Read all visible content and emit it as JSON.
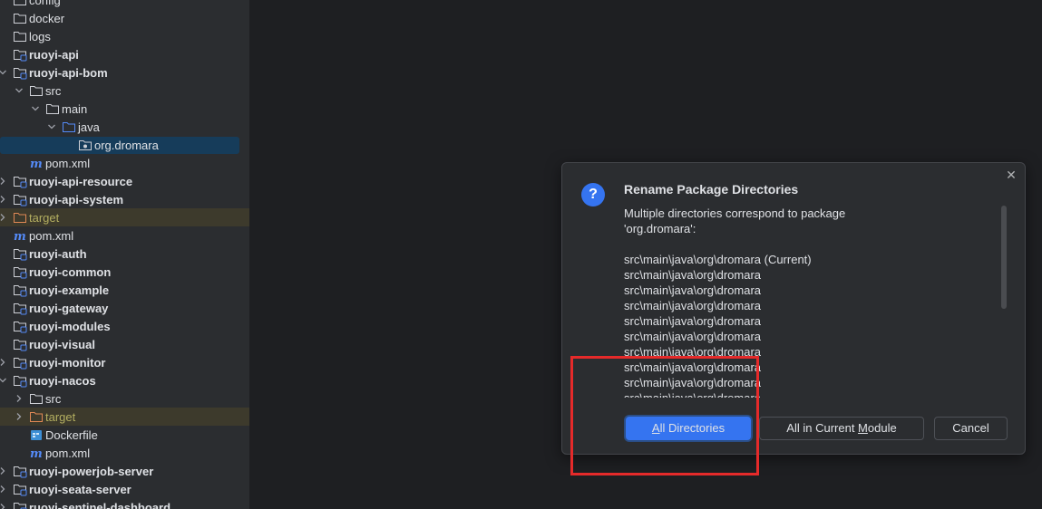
{
  "project_tree": [
    {
      "label": "config",
      "level": 0,
      "chevron": "none",
      "icon": "folder-icon",
      "style": "normal"
    },
    {
      "label": "docker",
      "level": 0,
      "chevron": "none",
      "icon": "folder-icon",
      "style": "normal"
    },
    {
      "label": "logs",
      "level": 0,
      "chevron": "none",
      "icon": "folder-icon",
      "style": "normal"
    },
    {
      "label": "ruoyi-api",
      "level": 0,
      "chevron": "none",
      "icon": "module-folder-icon",
      "style": "module"
    },
    {
      "label": "ruoyi-api-bom",
      "level": 0,
      "chevron": "down",
      "icon": "module-folder-icon",
      "style": "module"
    },
    {
      "label": "src",
      "level": 1,
      "chevron": "down",
      "icon": "folder-icon",
      "style": "normal"
    },
    {
      "label": "main",
      "level": 2,
      "chevron": "down",
      "icon": "folder-icon",
      "style": "normal"
    },
    {
      "label": "java",
      "level": 3,
      "chevron": "down",
      "icon": "source-folder-icon",
      "style": "normal"
    },
    {
      "label": "org.dromara",
      "level": 4,
      "chevron": "none",
      "icon": "package-icon",
      "style": "normal",
      "selected": true
    },
    {
      "label": "pom.xml",
      "level": 1,
      "chevron": "none",
      "icon": "maven-icon",
      "style": "normal"
    },
    {
      "label": "ruoyi-api-resource",
      "level": 0,
      "chevron": "right",
      "icon": "module-folder-icon",
      "style": "module"
    },
    {
      "label": "ruoyi-api-system",
      "level": 0,
      "chevron": "right",
      "icon": "module-folder-icon",
      "style": "module"
    },
    {
      "label": "target",
      "level": 0,
      "chevron": "right",
      "icon": "excluded-folder-icon",
      "style": "target"
    },
    {
      "label": "pom.xml",
      "level": 0,
      "chevron": "none",
      "icon": "maven-icon",
      "style": "normal"
    },
    {
      "label": "ruoyi-auth",
      "level": 0,
      "chevron": "none",
      "icon": "module-folder-icon",
      "style": "module"
    },
    {
      "label": "ruoyi-common",
      "level": 0,
      "chevron": "none",
      "icon": "module-folder-icon",
      "style": "module"
    },
    {
      "label": "ruoyi-example",
      "level": 0,
      "chevron": "none",
      "icon": "module-folder-icon",
      "style": "module"
    },
    {
      "label": "ruoyi-gateway",
      "level": 0,
      "chevron": "none",
      "icon": "module-folder-icon",
      "style": "module"
    },
    {
      "label": "ruoyi-modules",
      "level": 0,
      "chevron": "none",
      "icon": "module-folder-icon",
      "style": "module"
    },
    {
      "label": "ruoyi-visual",
      "level": 0,
      "chevron": "none",
      "icon": "module-folder-icon",
      "style": "module"
    },
    {
      "label": "ruoyi-monitor",
      "level": 0,
      "chevron": "right",
      "icon": "module-folder-icon",
      "style": "module"
    },
    {
      "label": "ruoyi-nacos",
      "level": 0,
      "chevron": "down",
      "icon": "module-folder-icon",
      "style": "module"
    },
    {
      "label": "src",
      "level": 1,
      "chevron": "right",
      "icon": "folder-icon",
      "style": "normal"
    },
    {
      "label": "target",
      "level": 1,
      "chevron": "right",
      "icon": "excluded-folder-icon",
      "style": "target"
    },
    {
      "label": "Dockerfile",
      "level": 1,
      "chevron": "none",
      "icon": "docker-icon",
      "style": "normal"
    },
    {
      "label": "pom.xml",
      "level": 1,
      "chevron": "none",
      "icon": "maven-icon",
      "style": "normal"
    },
    {
      "label": "ruoyi-powerjob-server",
      "level": 0,
      "chevron": "right",
      "icon": "module-folder-icon",
      "style": "module"
    },
    {
      "label": "ruoyi-seata-server",
      "level": 0,
      "chevron": "right",
      "icon": "module-folder-icon",
      "style": "module"
    },
    {
      "label": "ruoyi-sentinel-dashboard",
      "level": 0,
      "chevron": "right",
      "icon": "module-folder-icon",
      "style": "module"
    }
  ],
  "dialog": {
    "title": "Rename Package Directories",
    "message_line1": "Multiple directories correspond to package",
    "message_line2": "'org.dromara':",
    "directories": [
      "src\\main\\java\\org\\dromara (Current)",
      "src\\main\\java\\org\\dromara",
      "src\\main\\java\\org\\dromara",
      "src\\main\\java\\org\\dromara",
      "src\\main\\java\\org\\dromara",
      "src\\main\\java\\org\\dromara",
      "src\\main\\java\\org\\dromara",
      "src\\main\\java\\org\\dromara",
      "src\\main\\java\\org\\dromara",
      "src\\main\\java\\org\\dromara"
    ],
    "buttons": {
      "all_directories": {
        "mnemonic": "A",
        "rest": "ll Directories"
      },
      "all_in_module": {
        "before": "All in Current ",
        "mnemonic": "M",
        "after": "odule"
      },
      "cancel": "Cancel"
    },
    "close_glyph": "✕",
    "question_glyph": "?"
  },
  "colors": {
    "accent": "#3574f0",
    "highlight_box": "#e52a2a",
    "excluded_folder_text": "#b3ae60"
  }
}
